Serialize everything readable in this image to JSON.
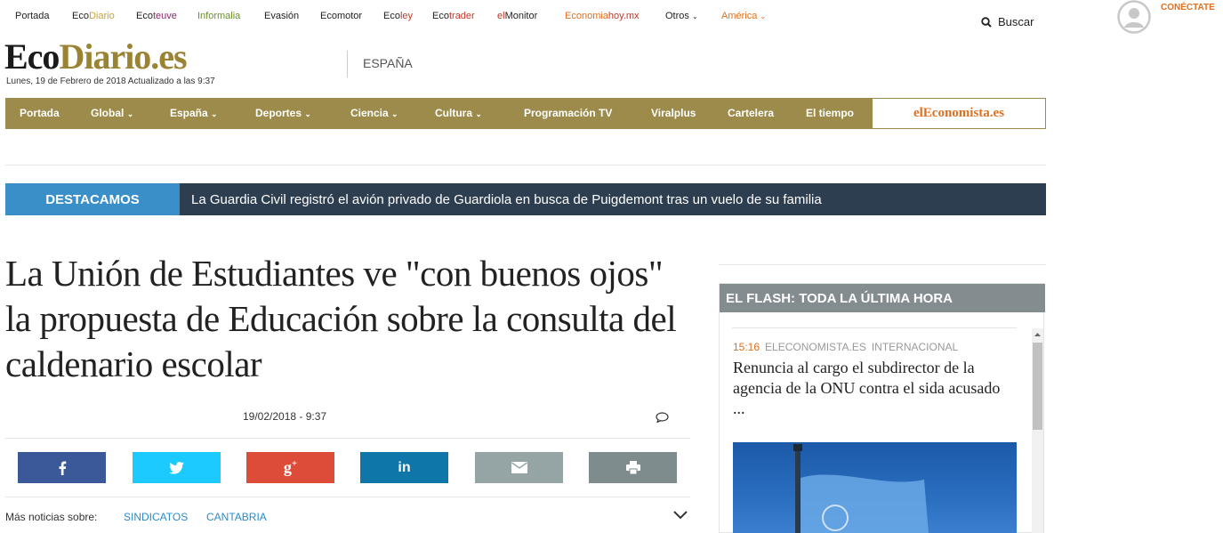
{
  "topnav": [
    {
      "label": "Portada"
    },
    {
      "label_a": "Eco",
      "label_b": "Diario"
    },
    {
      "label_a": "Eco",
      "label_b": "teuve"
    },
    {
      "label": "Informalia"
    },
    {
      "label": "Evasión"
    },
    {
      "label": "Ecomotor"
    },
    {
      "label_a": "Eco",
      "label_b": "ley"
    },
    {
      "label_a": "Eco",
      "label_b": "trader"
    },
    {
      "label_a": "el",
      "label_b": "Monitor"
    },
    {
      "label_a": "Economia",
      "label_b": "hoy.mx"
    },
    {
      "label": "Otros"
    },
    {
      "label": "América"
    }
  ],
  "search": {
    "label": "Buscar"
  },
  "user": {
    "login_label": "CONÉCTATE"
  },
  "logo": {
    "part1": "Eco",
    "part2": "Diario.es"
  },
  "date_line": "Lunes, 19 de Febrero de 2018 Actualizado a las 9:37",
  "section": "ESPAÑA",
  "mainnav": [
    {
      "label": "Portada"
    },
    {
      "label": "Global"
    },
    {
      "label": "España"
    },
    {
      "label": "Deportes"
    },
    {
      "label": "Ciencia"
    },
    {
      "label": "Cultura"
    },
    {
      "label": "Programación TV"
    },
    {
      "label": "Viralplus"
    },
    {
      "label": "Cartelera"
    },
    {
      "label": "El tiempo"
    }
  ],
  "partner": {
    "part1": "el",
    "part2": "Economista",
    "part3": ".es"
  },
  "destacamos": {
    "label": "DESTACAMOS",
    "text": "La Guardia Civil registró el avión privado de Guardiola en busca de Puigdemont tras un vuelo de su familia"
  },
  "article": {
    "headline": "La Unión de Estudiantes ve \"con buenos ojos\" la propuesta de Educación sobre la consulta del caldenario escolar",
    "date": "19/02/2018 - 9:37"
  },
  "share": [
    {
      "name": "facebook",
      "color": "#3b5998"
    },
    {
      "name": "twitter",
      "color": "#1dcaff"
    },
    {
      "name": "google-plus",
      "color": "#dd4b39"
    },
    {
      "name": "linkedin",
      "color": "#0e76a8"
    },
    {
      "name": "email",
      "color": "#95a5a6"
    },
    {
      "name": "print",
      "color": "#7f8c8d"
    }
  ],
  "tags": {
    "label": "Más noticias sobre:",
    "items": [
      "SINDICATOS",
      "CANTABRIA"
    ]
  },
  "flash": {
    "title": "EL FLASH: TODA LA ÚLTIMA HORA",
    "item": {
      "time": "15:16",
      "source": "ELECONOMISTA.ES",
      "category": "INTERNACIONAL",
      "headline": "Renuncia al cargo el subdirector de la agencia de la ONU contra el sida acusado ..."
    }
  },
  "colors": {
    "brand_gold": "#9c8b4a",
    "accent_orange": "#e0701f",
    "destacamos_blue": "#3a8fc8",
    "dark_bar": "#2c3e50",
    "link_blue": "#2a8bc9"
  }
}
